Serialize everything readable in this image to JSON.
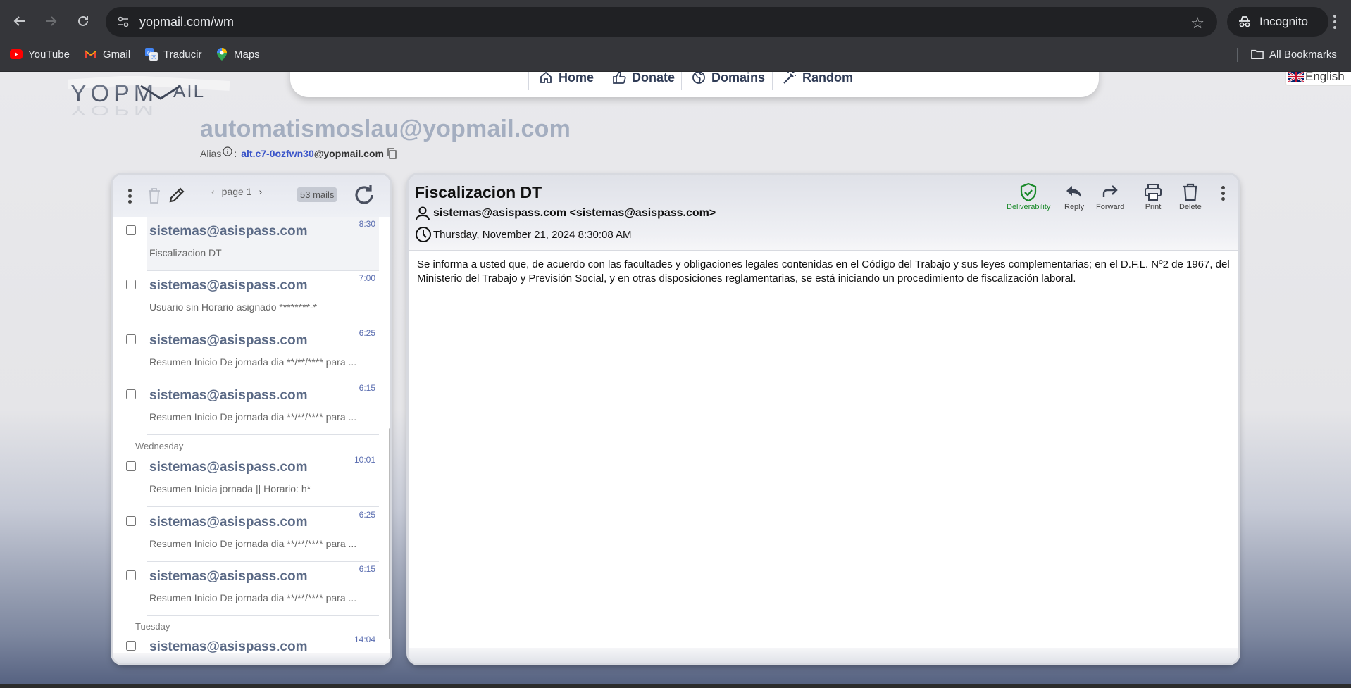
{
  "browser": {
    "url": "yopmail.com/wm",
    "profile_label": "Incognito",
    "bookmarks": [
      {
        "label": "YouTube",
        "icon": "youtube-icon"
      },
      {
        "label": "Gmail",
        "icon": "gmail-icon"
      },
      {
        "label": "Traducir",
        "icon": "translate-icon"
      },
      {
        "label": "Maps",
        "icon": "maps-icon"
      }
    ],
    "all_bookmarks_label": "All Bookmarks"
  },
  "site": {
    "logo_text": "YOPMAIL",
    "nav": [
      {
        "label": "Home",
        "icon": "home-icon"
      },
      {
        "label": "Donate",
        "icon": "thumbs-up-icon"
      },
      {
        "label": "Domains",
        "icon": "globe-icon"
      },
      {
        "label": "Random",
        "icon": "magic-wand-icon"
      }
    ],
    "language": "English",
    "inbox_address": "automatismoslau@yopmail.com",
    "alias_label": "Alias",
    "alias_separator": ":",
    "alias_user": "alt.c7-0ozfwn30",
    "alias_domain": "@yopmail.com"
  },
  "mail_list": {
    "page_label": "page 1",
    "mail_count": "53 mails",
    "items": [
      {
        "from": "sistemas@asispass.com",
        "time": "8:30",
        "subject": "Fiscalizacion DT"
      },
      {
        "from": "sistemas@asispass.com",
        "time": "7:00",
        "subject": "Usuario sin Horario asignado ********-*"
      },
      {
        "from": "sistemas@asispass.com",
        "time": "6:25",
        "subject": "Resumen Inicio De jornada dia **/**/**** para ..."
      },
      {
        "from": "sistemas@asispass.com",
        "time": "6:15",
        "subject": "Resumen Inicio De jornada dia **/**/**** para ..."
      },
      {
        "from": "sistemas@asispass.com",
        "time": "10:01",
        "subject": "Resumen Inicia jornada || Horario: h*"
      },
      {
        "from": "sistemas@asispass.com",
        "time": "6:25",
        "subject": "Resumen Inicio De jornada dia **/**/**** para ..."
      },
      {
        "from": "sistemas@asispass.com",
        "time": "6:15",
        "subject": "Resumen Inicio De jornada dia **/**/**** para ..."
      },
      {
        "from": "sistemas@asispass.com",
        "time": "14:04",
        "subject": ""
      }
    ],
    "day_labels": [
      "Wednesday",
      "Tuesday"
    ]
  },
  "message": {
    "title": "Fiscalizacion DT",
    "sender": "sistemas@asispass.com <sistemas@asispass.com>",
    "date": "Thursday, November 21, 2024 8:30:08 AM",
    "actions": [
      {
        "label": "Deliverability",
        "icon": "shield-check-icon",
        "color": "#1a8a2a"
      },
      {
        "label": "Reply",
        "icon": "reply-icon"
      },
      {
        "label": "Forward",
        "icon": "forward-icon"
      },
      {
        "label": "Print",
        "icon": "printer-icon"
      },
      {
        "label": "Delete",
        "icon": "trash-icon"
      }
    ],
    "body": "Se informa a usted que, de acuerdo con las facultades y obligaciones legales contenidas en el Código del Trabajo y sus leyes complementarias; en el D.F.L. Nº2 de 1967, del Ministerio del Trabajo y Previsión Social, y en otras disposiciones reglamentarias, se está iniciando un procedimiento de fiscalización laboral."
  },
  "colors": {
    "chrome_bg": "#35363a",
    "inbox_name": "#a4aec0",
    "sender_bold": "#5b6a86",
    "alias_link": "#3b55c9",
    "time_text": "#5a6db0"
  }
}
